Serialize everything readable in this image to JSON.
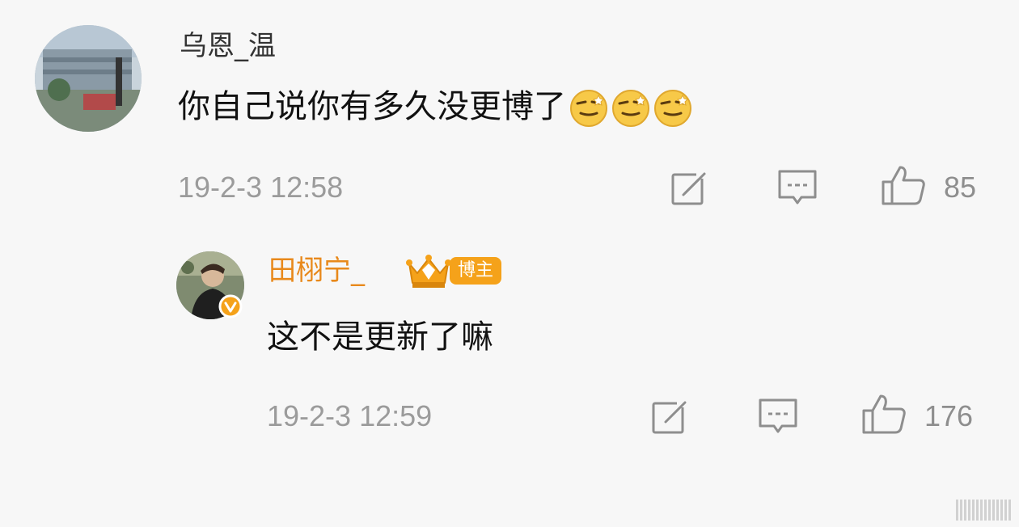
{
  "comments": [
    {
      "username": "乌恩_温",
      "username_color": "#333333",
      "text": "你自己说你有多久没更博了",
      "emoji": [
        "grimace-emoji",
        "grimace-emoji",
        "grimace-emoji"
      ],
      "timestamp": "19-2-3 12:58",
      "actions": {
        "share_icon": "share-edit-icon",
        "comment_icon": "comment-icon",
        "like_icon": "thumbs-up-icon",
        "like_count": "85"
      }
    },
    {
      "username": "田栩宁_",
      "username_color": "#e8891b",
      "badge_label": "博主",
      "verified_icon": "verified-v-icon",
      "text": "这不是更新了嘛",
      "timestamp": "19-2-3 12:59",
      "actions": {
        "share_icon": "share-edit-icon",
        "comment_icon": "comment-icon",
        "like_icon": "thumbs-up-icon",
        "like_count": "176"
      }
    }
  ],
  "colors": {
    "background": "#f7f7f7",
    "muted": "#9b9b9b",
    "accent": "#f5a21a"
  }
}
